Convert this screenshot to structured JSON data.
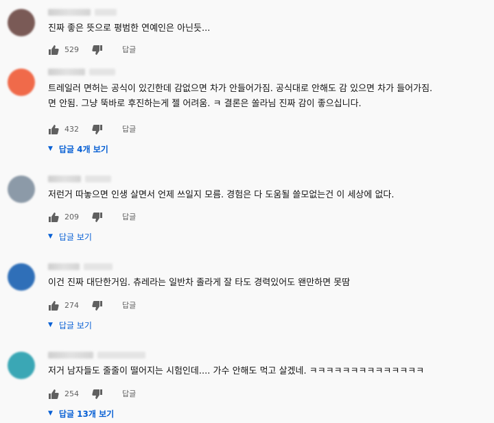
{
  "comments": [
    {
      "avatar_color": "#7a5a56",
      "text": "진짜 좋은 뜻으로 평범한 연예인은 아닌듯...",
      "likes": "529",
      "reply_label": "답글"
    },
    {
      "avatar_color": "#f06a4a",
      "text": "트레일러 면허는 공식이 있긴한데 감없으면 차가 안들어가짐. 공식대로 안해도 감 있으면 차가 들어가짐.\n면 안됨. 그냥 뚝바로 후진하는게 젤 어려움. ㅋ 결론은 쏠라님 진짜 감이 좋으십니다.",
      "likes": "432",
      "reply_label": "답글",
      "view_replies": "답글 4개 보기"
    },
    {
      "avatar_color": "#8c9aa8",
      "text": "저런거 따놓으면 인생 살면서 언제 쓰일지 모름. 경험은 다 도움될 쓸모없는건 이 세상에 없다.",
      "likes": "209",
      "reply_label": "답글",
      "view_replies": "답글 보기"
    },
    {
      "avatar_color": "#2f6fb8",
      "text": "이건 진짜 대단한거임. 츄레라는 일반차 졸라게 잘 타도 경력있어도 왠만하면 못땀",
      "likes": "274",
      "reply_label": "답글",
      "view_replies": "답글 보기"
    },
    {
      "avatar_color": "#3aa7b5",
      "text": "저거 남자들도 줄줄이 떨어지는 시험인데.... 가수 안해도 먹고 살겠네. ㅋㅋㅋㅋㅋㅋㅋㅋㅋㅋㅋㅋㅋㅋ",
      "likes": "254",
      "reply_label": "답글",
      "view_replies": "답글 13개 보기"
    }
  ]
}
